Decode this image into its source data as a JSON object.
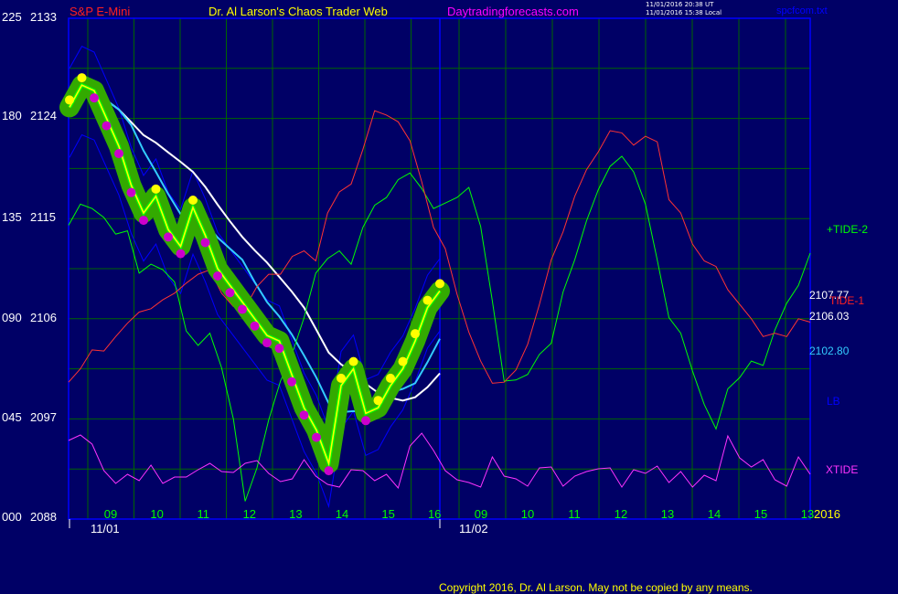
{
  "header": {
    "symbol": "S&P E-Mini",
    "title": "Dr. Al Larson's Chaos Trader Web",
    "site": "Daytradingforecasts.com",
    "timestamp_utc": "11/01/2016 20:38 UT",
    "timestamp_local": "11/01/2016 15:38 Local",
    "file": "spcfcom.txt",
    "copyright": "Copyright 2016, Dr. Al Larson. May not be copied by any means."
  },
  "colors": {
    "background": "#000066",
    "grid": "#006600",
    "axis": "#0000ff",
    "symbol": "#ff2020",
    "title": "#ffff00",
    "site": "#ff00ff",
    "tide2": "#00ff00",
    "tide1": "#ff3333",
    "lb": "#0000ff",
    "xtide": "#ff33ff",
    "cyan": "#33ccff",
    "white": "#ffffff",
    "yellow": "#ffff00"
  },
  "chart_data": {
    "type": "line",
    "x_ticks": [
      "09",
      "10",
      "11",
      "12",
      "13",
      "14",
      "15",
      "16",
      "09",
      "10",
      "11",
      "12",
      "13",
      "14",
      "15",
      "13"
    ],
    "date_labels": [
      "11/01",
      "11/02"
    ],
    "year_label": "2016",
    "y_ticks": [
      {
        "osc": "000",
        "price": "2088"
      },
      {
        "osc": "045",
        "price": "2097"
      },
      {
        "osc": "090",
        "price": "2106"
      },
      {
        "osc": "135",
        "price": "2115"
      },
      {
        "osc": "180",
        "price": "2124"
      },
      {
        "osc": "225",
        "price": "2133"
      }
    ],
    "ylim": [
      2088,
      2133
    ],
    "right_labels": {
      "tide2": "+TIDE-2",
      "tide1": "TIDE-1",
      "lb": "LB",
      "xtide": "XTIDE",
      "last_price": "2107.77",
      "ma1": "2106.03",
      "ma2": "2102.80"
    },
    "series": [
      {
        "name": "+TIDE-2",
        "values": [
          2114.4,
          2116.3,
          2115.9,
          2115.1,
          2113.6,
          2113.9,
          2110.1,
          2110.9,
          2110.4,
          2109.3,
          2104.9,
          2103.6,
          2104.7,
          2101.6,
          2097.0,
          2089.6,
          2092.6,
          2096.9,
          2100.4,
          2102.9,
          2106.1,
          2110.1,
          2111.4,
          2112.1,
          2110.9,
          2114.2,
          2116.2,
          2116.9,
          2118.5,
          2119.1,
          2117.7,
          2115.9,
          2116.4,
          2116.9,
          2117.8,
          2114.3,
          2107.6,
          2100.4,
          2100.5,
          2101.0,
          2102.8,
          2103.8,
          2108.4,
          2111.3,
          2114.8,
          2117.6,
          2119.7,
          2120.6,
          2119.2,
          2116.3,
          2111.3,
          2106.1,
          2104.7,
          2101.3,
          2098.3,
          2096.1,
          2099.7,
          2100.7,
          2102.2,
          2101.8,
          2105.0,
          2107.4,
          2109.0,
          2111.9
        ]
      },
      {
        "name": "TIDE-1",
        "values": [
          2100.3,
          2101.5,
          2103.2,
          2103.1,
          2104.4,
          2105.6,
          2106.6,
          2106.9,
          2107.7,
          2108.3,
          2109.2,
          2110.0,
          2110.4,
          2108.3,
          2107.1,
          2107.0,
          2108.9,
          2110.0,
          2110.0,
          2111.6,
          2112.1,
          2111.2,
          2115.5,
          2117.4,
          2118.1,
          2121.2,
          2124.7,
          2124.3,
          2123.7,
          2122.0,
          2118.3,
          2114.2,
          2112.3,
          2108.2,
          2104.8,
          2102.2,
          2100.2,
          2100.3,
          2101.4,
          2103.7,
          2107.3,
          2111.3,
          2113.8,
          2117.0,
          2119.4,
          2121.0,
          2122.9,
          2122.7,
          2121.6,
          2122.4,
          2121.9,
          2116.7,
          2115.5,
          2112.7,
          2111.2,
          2110.7,
          2108.6,
          2107.3,
          2106.0,
          2104.4,
          2104.7,
          2104.4,
          2106.0,
          2105.7
        ]
      },
      {
        "name": "XTIDE",
        "values": [
          0.88,
          0.94,
          0.84,
          0.55,
          0.41,
          0.51,
          0.44,
          0.61,
          0.41,
          0.48,
          0.48,
          0.56,
          0.63,
          0.54,
          0.53,
          0.63,
          0.66,
          0.52,
          0.43,
          0.46,
          0.67,
          0.49,
          0.4,
          0.37,
          0.56,
          0.55,
          0.44,
          0.51,
          0.36,
          0.82,
          0.96,
          0.77,
          0.55,
          0.45,
          0.42,
          0.37,
          0.7,
          0.49,
          0.46,
          0.38,
          0.58,
          0.59,
          0.38,
          0.49,
          0.54,
          0.57,
          0.58,
          0.37,
          0.56,
          0.52,
          0.6,
          0.42,
          0.54,
          0.37,
          0.5,
          0.44,
          0.93,
          0.69,
          0.59,
          0.67,
          0.45,
          0.38,
          0.7,
          0.51
        ]
      },
      {
        "name": "Price",
        "values": [
          2125.0,
          2127.0,
          2126.5,
          2124.0,
          2121.5,
          2118.0,
          2115.5,
          2117.0,
          2114.0,
          2112.5,
          2116.0,
          2113.5,
          2110.5,
          2109.0,
          2107.5,
          2106.0,
          2104.5,
          2104.0,
          2101.0,
          2098.0,
          2096.0,
          2093.0,
          2100.0,
          2101.5,
          2097.5,
          2098.0,
          2100.0,
          2101.5,
          2104.0,
          2107.0,
          2108.5
        ]
      }
    ]
  }
}
